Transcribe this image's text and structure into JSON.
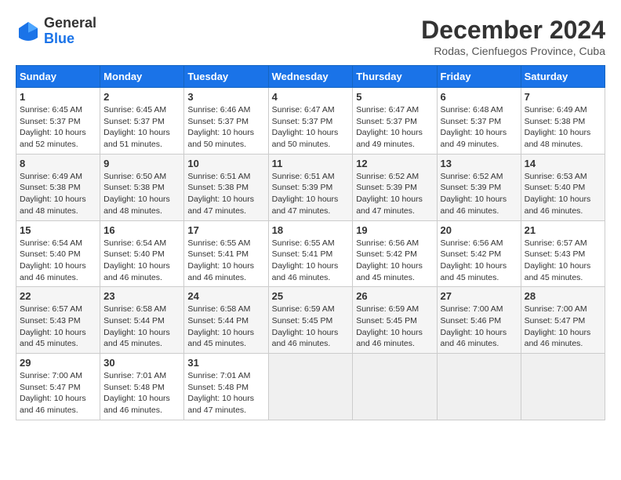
{
  "logo": {
    "general": "General",
    "blue": "Blue"
  },
  "title": "December 2024",
  "subtitle": "Rodas, Cienfuegos Province, Cuba",
  "weekdays": [
    "Sunday",
    "Monday",
    "Tuesday",
    "Wednesday",
    "Thursday",
    "Friday",
    "Saturday"
  ],
  "weeks": [
    [
      {
        "day": "1",
        "sunrise": "6:45 AM",
        "sunset": "5:37 PM",
        "daylight": "10 hours and 52 minutes."
      },
      {
        "day": "2",
        "sunrise": "6:45 AM",
        "sunset": "5:37 PM",
        "daylight": "10 hours and 51 minutes."
      },
      {
        "day": "3",
        "sunrise": "6:46 AM",
        "sunset": "5:37 PM",
        "daylight": "10 hours and 50 minutes."
      },
      {
        "day": "4",
        "sunrise": "6:47 AM",
        "sunset": "5:37 PM",
        "daylight": "10 hours and 50 minutes."
      },
      {
        "day": "5",
        "sunrise": "6:47 AM",
        "sunset": "5:37 PM",
        "daylight": "10 hours and 49 minutes."
      },
      {
        "day": "6",
        "sunrise": "6:48 AM",
        "sunset": "5:37 PM",
        "daylight": "10 hours and 49 minutes."
      },
      {
        "day": "7",
        "sunrise": "6:49 AM",
        "sunset": "5:38 PM",
        "daylight": "10 hours and 48 minutes."
      }
    ],
    [
      {
        "day": "8",
        "sunrise": "6:49 AM",
        "sunset": "5:38 PM",
        "daylight": "10 hours and 48 minutes."
      },
      {
        "day": "9",
        "sunrise": "6:50 AM",
        "sunset": "5:38 PM",
        "daylight": "10 hours and 48 minutes."
      },
      {
        "day": "10",
        "sunrise": "6:51 AM",
        "sunset": "5:38 PM",
        "daylight": "10 hours and 47 minutes."
      },
      {
        "day": "11",
        "sunrise": "6:51 AM",
        "sunset": "5:39 PM",
        "daylight": "10 hours and 47 minutes."
      },
      {
        "day": "12",
        "sunrise": "6:52 AM",
        "sunset": "5:39 PM",
        "daylight": "10 hours and 47 minutes."
      },
      {
        "day": "13",
        "sunrise": "6:52 AM",
        "sunset": "5:39 PM",
        "daylight": "10 hours and 46 minutes."
      },
      {
        "day": "14",
        "sunrise": "6:53 AM",
        "sunset": "5:40 PM",
        "daylight": "10 hours and 46 minutes."
      }
    ],
    [
      {
        "day": "15",
        "sunrise": "6:54 AM",
        "sunset": "5:40 PM",
        "daylight": "10 hours and 46 minutes."
      },
      {
        "day": "16",
        "sunrise": "6:54 AM",
        "sunset": "5:40 PM",
        "daylight": "10 hours and 46 minutes."
      },
      {
        "day": "17",
        "sunrise": "6:55 AM",
        "sunset": "5:41 PM",
        "daylight": "10 hours and 46 minutes."
      },
      {
        "day": "18",
        "sunrise": "6:55 AM",
        "sunset": "5:41 PM",
        "daylight": "10 hours and 46 minutes."
      },
      {
        "day": "19",
        "sunrise": "6:56 AM",
        "sunset": "5:42 PM",
        "daylight": "10 hours and 45 minutes."
      },
      {
        "day": "20",
        "sunrise": "6:56 AM",
        "sunset": "5:42 PM",
        "daylight": "10 hours and 45 minutes."
      },
      {
        "day": "21",
        "sunrise": "6:57 AM",
        "sunset": "5:43 PM",
        "daylight": "10 hours and 45 minutes."
      }
    ],
    [
      {
        "day": "22",
        "sunrise": "6:57 AM",
        "sunset": "5:43 PM",
        "daylight": "10 hours and 45 minutes."
      },
      {
        "day": "23",
        "sunrise": "6:58 AM",
        "sunset": "5:44 PM",
        "daylight": "10 hours and 45 minutes."
      },
      {
        "day": "24",
        "sunrise": "6:58 AM",
        "sunset": "5:44 PM",
        "daylight": "10 hours and 45 minutes."
      },
      {
        "day": "25",
        "sunrise": "6:59 AM",
        "sunset": "5:45 PM",
        "daylight": "10 hours and 46 minutes."
      },
      {
        "day": "26",
        "sunrise": "6:59 AM",
        "sunset": "5:45 PM",
        "daylight": "10 hours and 46 minutes."
      },
      {
        "day": "27",
        "sunrise": "7:00 AM",
        "sunset": "5:46 PM",
        "daylight": "10 hours and 46 minutes."
      },
      {
        "day": "28",
        "sunrise": "7:00 AM",
        "sunset": "5:47 PM",
        "daylight": "10 hours and 46 minutes."
      }
    ],
    [
      {
        "day": "29",
        "sunrise": "7:00 AM",
        "sunset": "5:47 PM",
        "daylight": "10 hours and 46 minutes."
      },
      {
        "day": "30",
        "sunrise": "7:01 AM",
        "sunset": "5:48 PM",
        "daylight": "10 hours and 46 minutes."
      },
      {
        "day": "31",
        "sunrise": "7:01 AM",
        "sunset": "5:48 PM",
        "daylight": "10 hours and 47 minutes."
      },
      null,
      null,
      null,
      null
    ]
  ]
}
